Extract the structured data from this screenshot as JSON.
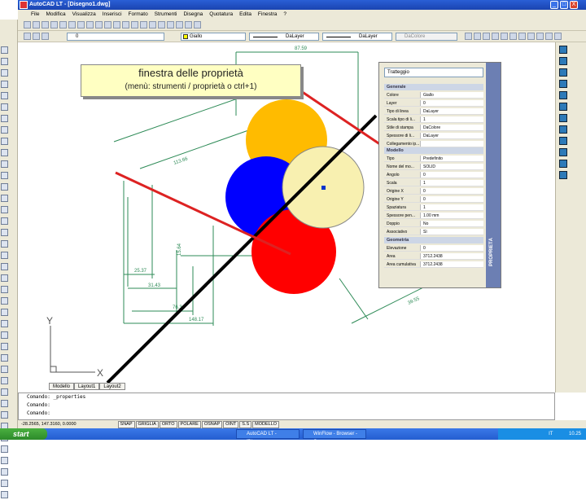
{
  "window": {
    "title": "AutoCAD LT - [Disegno1.dwg]",
    "buttons": [
      "_",
      "□",
      "X"
    ]
  },
  "menu": {
    "items": [
      "File",
      "Modifica",
      "Visualizza",
      "Inserisci",
      "Formato",
      "Strumenti",
      "Disegna",
      "Quotatura",
      "Edita",
      "Finestra",
      "?"
    ]
  },
  "layer_toolbar": {
    "layer_value": "0",
    "current_layer": "Giallo",
    "linetype1": "DaLayer",
    "linetype2": "DaLayer",
    "plotstyle": "DaColore"
  },
  "callout": {
    "title": "finestra delle proprietà",
    "subtitle": "(menù: strumenti / proprietà o ctrl+1)"
  },
  "properties": {
    "selector": "Tratteggio",
    "side_label": "PROPRIETÀ",
    "sections": [
      {
        "name": "Generale",
        "rows": [
          [
            "Colore",
            "Giallo"
          ],
          [
            "Layer",
            "0"
          ],
          [
            "Tipo di linea",
            "DaLayer"
          ],
          [
            "Scala tipo di li...",
            "1"
          ],
          [
            "Stile di stampa",
            "DaColore"
          ],
          [
            "Spessore di li...",
            "DaLayer"
          ],
          [
            "Collegamento ip...",
            ""
          ]
        ]
      },
      {
        "name": "Modello",
        "rows": [
          [
            "Tipo",
            "Predefinito"
          ],
          [
            "Nome del mo...",
            "SOLID"
          ],
          [
            "Angolo",
            "0"
          ],
          [
            "Scala",
            "1"
          ],
          [
            "Origine X",
            "0"
          ],
          [
            "Origine Y",
            "0"
          ],
          [
            "Spaziatura",
            "1"
          ],
          [
            "Spessore pen...",
            "1.00 mm"
          ],
          [
            "Doppio",
            "No"
          ],
          [
            "Associativo",
            "Sì"
          ],
          [
            "Stile di individ...",
            "Normale"
          ]
        ]
      },
      {
        "name": "Geometria",
        "rows": [
          [
            "Elevazione",
            "0"
          ],
          [
            "Area",
            "3712.2438"
          ],
          [
            "Area cumulativa",
            "3712.2438"
          ]
        ]
      }
    ]
  },
  "drawing": {
    "dims": [
      "87.59",
      "113.66",
      "25.37",
      "31.43",
      "76.3",
      "148.17",
      "15.64",
      "39.55"
    ],
    "axis_y": "Y",
    "axis_x": "X",
    "colors": {
      "yellow": "#ffbb00",
      "blue": "#0000ff",
      "red": "#ff0000",
      "pale": "#f8f0b0",
      "green": "#2e8b57",
      "arrow": "#dd2222"
    }
  },
  "tabs": [
    "Modello",
    "Layout1",
    "Layout2"
  ],
  "command": {
    "lines": [
      "Comando:  _properties",
      "Comando:",
      "Comando:"
    ]
  },
  "status": {
    "coords": "-28.2565, 147.3160, 0.0000",
    "buttons": [
      "SNAP",
      "GRIGLIA",
      "ORTO",
      "POLARE",
      "OSNAP",
      "OINT",
      "S.S",
      "MODELLO"
    ]
  },
  "taskbar": {
    "start": "start",
    "items": [
      "AutoCAD LT - [Disegno...",
      "WinFlow - Browser - C..."
    ],
    "tray_lang": "IT",
    "clock": "10.25"
  }
}
